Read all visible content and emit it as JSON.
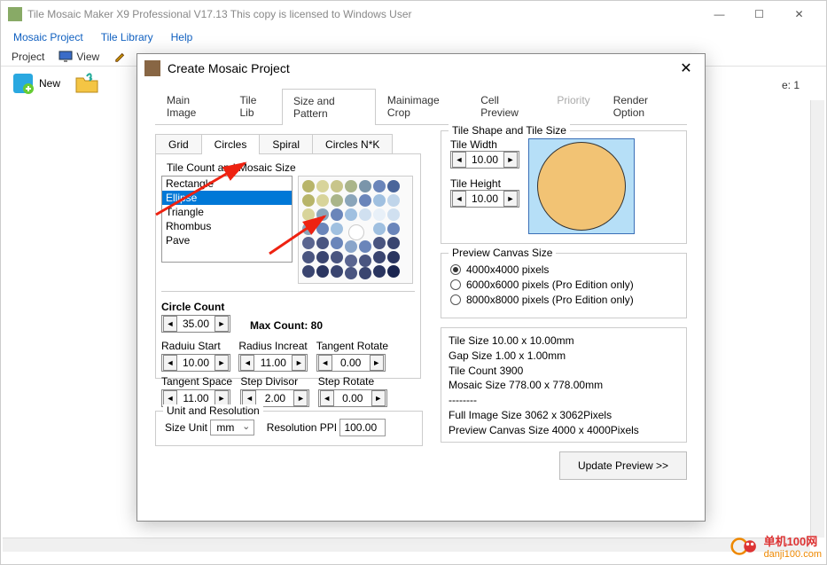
{
  "window": {
    "title": "Tile Mosaic Maker X9 Professional V17.13   This copy is licensed to Windows User"
  },
  "menu": {
    "items": [
      "Mosaic Project",
      "Tile Library",
      "Help"
    ]
  },
  "toolbar": {
    "project": "Project",
    "view": "View",
    "new": "New"
  },
  "status": {
    "right": "e: 1"
  },
  "dialog": {
    "title": "Create Mosaic Project",
    "tabs": [
      "Main Image",
      "Tile Lib",
      "Size and Pattern",
      "Mainimage Crop",
      "Cell Preview",
      "Priority",
      "Render Option"
    ],
    "active_tab": 2,
    "subtabs": [
      "Grid",
      "Circles",
      "Spiral",
      "Circles N*K"
    ],
    "active_subtab": 1,
    "tile_count_label": "Tile Count and Mosaic Size",
    "shape_options": [
      "Rectangle",
      "Ellipse",
      "Triangle",
      "Rhombus",
      "Pave"
    ],
    "shape_selected": 1,
    "circle_count": {
      "label": "Circle Count",
      "value": "35.00"
    },
    "max_count": "Max Count: 80",
    "radius_start": {
      "label": "Raduiu Start",
      "value": "10.00"
    },
    "radius_increat": {
      "label": "Radius Increat",
      "value": "11.00"
    },
    "tangent_rotate": {
      "label": "Tangent Rotate",
      "value": "0.00"
    },
    "tangent_space": {
      "label": "Tangent Space",
      "value": "11.00"
    },
    "step_divisor": {
      "label": "Step Divisor",
      "value": "2.00"
    },
    "step_rotate": {
      "label": "Step Rotate",
      "value": "0.00"
    },
    "unit_reso": {
      "legend": "Unit and Resolution",
      "size_unit_label": "Size Unit",
      "size_unit": "mm",
      "res_label": "Resolution PPI",
      "res_value": "100.00"
    },
    "tile_shape": {
      "legend": "Tile Shape and Tile Size",
      "width_label": "Tile Width",
      "width": "10.00",
      "height_label": "Tile Height",
      "height": "10.00"
    },
    "canvas": {
      "legend": "Preview Canvas Size",
      "opt1": "4000x4000 pixels",
      "opt2": "6000x6000 pixels (Pro Edition only)",
      "opt3": "8000x8000 pixels (Pro Edition only)",
      "selected": 0
    },
    "info": {
      "l1": "Tile Size 10.00 x 10.00mm",
      "l2": "Gap Size 1.00 x 1.00mm",
      "l3": "Tile Count 3900",
      "l4": "Mosaic Size 778.00 x 778.00mm",
      "l5": "--------",
      "l6": "Full Image Size 3062 x 3062Pixels",
      "l7": "Preview Canvas Size 4000 x 4000Pixels"
    },
    "update_btn": "Update Preview >>"
  },
  "watermark": {
    "line1": "单机100网",
    "line2": "danji100.com"
  }
}
